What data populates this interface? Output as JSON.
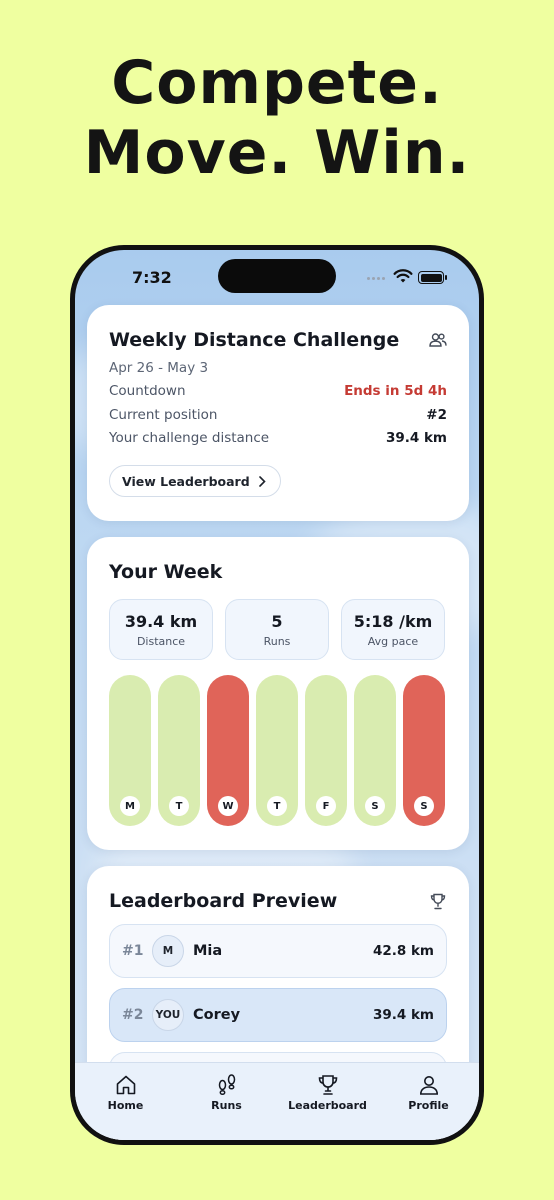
{
  "headline": {
    "line1": "Compete.",
    "line2": "Move. Win."
  },
  "status_bar": {
    "time": "7:32"
  },
  "challenge": {
    "title": "Weekly Distance Challenge",
    "dates": "Apr 26 - May 3",
    "rows": [
      {
        "label": "Countdown",
        "value": "Ends in 5d 4h"
      },
      {
        "label": "Current position",
        "value": "#2"
      },
      {
        "label": "Your challenge distance",
        "value": "39.4 km"
      }
    ],
    "button_label": "View Leaderboard",
    "icon": "group-icon"
  },
  "week": {
    "title": "Your Week",
    "stats": [
      {
        "value": "39.4 km",
        "label": "Distance"
      },
      {
        "value": "5",
        "label": "Runs"
      },
      {
        "value": "5:18 /km",
        "label": "Avg pace"
      }
    ],
    "days": [
      {
        "label": "M",
        "status": "ran"
      },
      {
        "label": "T",
        "status": "ran"
      },
      {
        "label": "W",
        "status": "missed"
      },
      {
        "label": "T",
        "status": "ran"
      },
      {
        "label": "F",
        "status": "ran"
      },
      {
        "label": "S",
        "status": "ran"
      },
      {
        "label": "S",
        "status": "missed"
      }
    ],
    "colors": {
      "ran": "#d9ecb0",
      "missed": "#e06459"
    }
  },
  "leaderboard": {
    "title": "Leaderboard Preview",
    "icon": "trophy-icon",
    "rows": [
      {
        "rank": "#1",
        "avatar": "M",
        "name": "Mia",
        "distance": "42.8 km"
      },
      {
        "rank": "#2",
        "avatar": "YOU",
        "name": "Corey",
        "distance": "39.4 km"
      }
    ]
  },
  "tabs": [
    {
      "label": "Home",
      "icon": "home-icon"
    },
    {
      "label": "Runs",
      "icon": "footprints-icon"
    },
    {
      "label": "Leaderboard",
      "icon": "trophy-icon"
    },
    {
      "label": "Profile",
      "icon": "person-icon"
    }
  ],
  "colors": {
    "background": "#efffa0",
    "alert": "#c53b34",
    "accent_row": "#d9e7f8"
  }
}
